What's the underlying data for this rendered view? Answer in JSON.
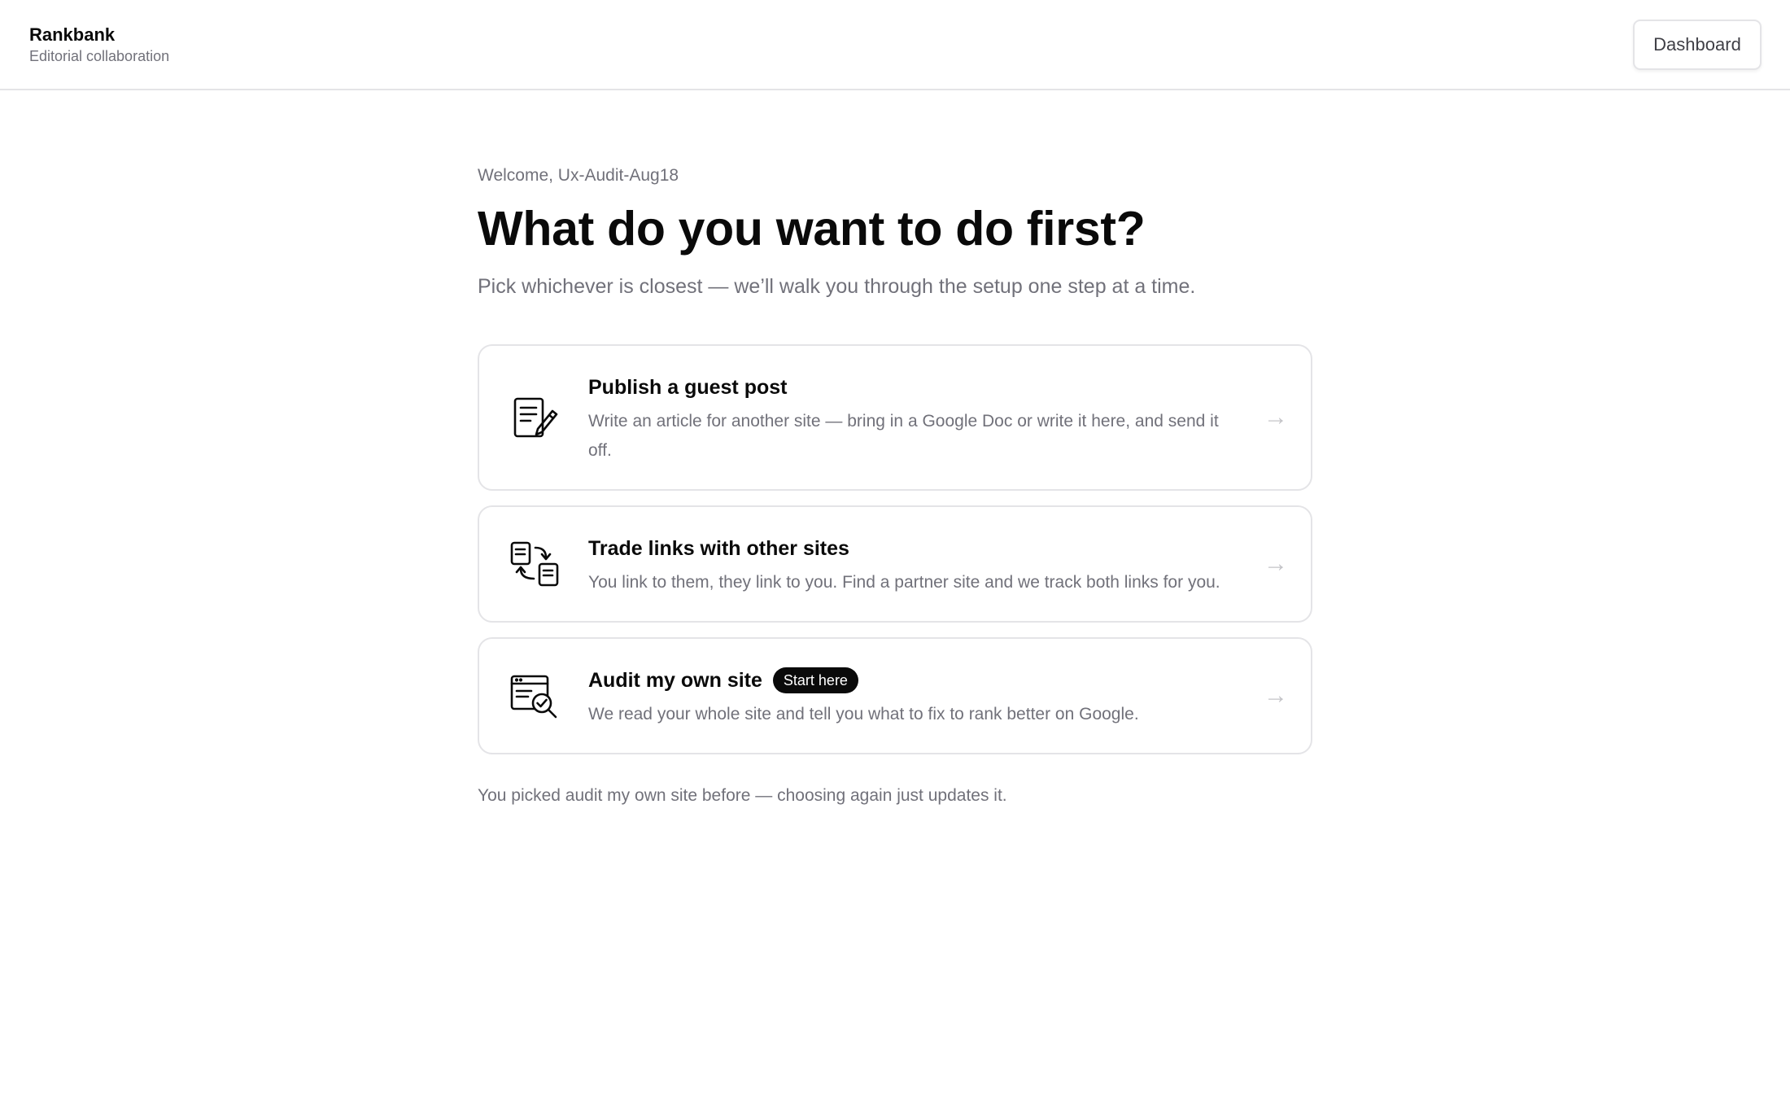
{
  "header": {
    "brand_name": "Rankbank",
    "brand_tagline": "Editorial collaboration",
    "dashboard_label": "Dashboard"
  },
  "main": {
    "welcome": "Welcome, Ux-Audit-Aug18",
    "headline": "What do you want to do first?",
    "subhead": "Pick whichever is closest — we’ll walk you through the setup one step at a time.",
    "options": [
      {
        "icon": "document-pen-icon",
        "title": "Publish a guest post",
        "description": "Write an article for another site — bring in a Google Doc or write it here, and send it off.",
        "arrow": "→"
      },
      {
        "icon": "link-exchange-icon",
        "title": "Trade links with other sites",
        "description": "You link to them, they link to you. Find a partner site and we track both links for you.",
        "arrow": "→"
      },
      {
        "icon": "site-audit-icon",
        "title": "Audit my own site",
        "badge": "Start here",
        "description": "We read your whole site and tell you what to fix to rank better on Google.",
        "arrow": "→"
      }
    ],
    "footnote": "You picked audit my own site before — choosing again just updates it."
  },
  "colors": {
    "text_primary": "#0a0a0a",
    "text_muted": "#71717a",
    "border": "#e4e4e7",
    "badge_bg": "#0a0a0a",
    "badge_text": "#ffffff",
    "arrow": "#c4c4c8"
  }
}
